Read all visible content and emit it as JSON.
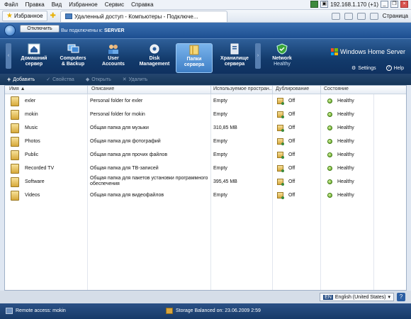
{
  "ie_menu": {
    "items": [
      "Файл",
      "Правка",
      "Вид",
      "Избранное",
      "Сервис",
      "Справка"
    ]
  },
  "ie_status": {
    "address": "192.168.1.170 (+1)"
  },
  "ie_bar": {
    "favorites": "Избранное",
    "tab_title": "Удаленный доступ - Компьютеры - Подключе...",
    "page_label": "Страница"
  },
  "rdp": {
    "disconnect": "Отключить",
    "connected_to": "Вы подключены к:",
    "server": "SERVER"
  },
  "whs": {
    "logo": "Windows Home Server",
    "tabs": [
      {
        "line1": "Домашний",
        "line2": "сервер"
      },
      {
        "line1": "Computers",
        "line2": "& Backup"
      },
      {
        "line1": "User",
        "line2": "Accounts"
      },
      {
        "line1": "Disk",
        "line2": "Management"
      },
      {
        "line1": "Папки",
        "line2": "сервера"
      },
      {
        "line1": "Хранилище",
        "line2": "сервера"
      }
    ],
    "network": {
      "label": "Network",
      "status": "Healthy"
    },
    "settings": "Settings",
    "help": "Help"
  },
  "toolbar": {
    "add": "Добавить",
    "properties": "Свойства",
    "open": "Открыть",
    "delete": "Удалить"
  },
  "table": {
    "headers": {
      "name": "Имя",
      "desc": "Описание",
      "used": "Используемое простран...",
      "dup": "Дублирование",
      "status": "Состояние"
    },
    "rows": [
      {
        "name": "exler",
        "desc": "Personal folder for exler",
        "used": "Empty",
        "dup": "Off",
        "status": "Healthy",
        "icon": "user-folder"
      },
      {
        "name": "mokin",
        "desc": "Personal folder for mokin",
        "used": "Empty",
        "dup": "Off",
        "status": "Healthy",
        "icon": "user-folder"
      },
      {
        "name": "Music",
        "desc": "Общая папка для музыки",
        "used": "310,85 MB",
        "dup": "Off",
        "status": "Healthy",
        "icon": "music-folder"
      },
      {
        "name": "Photos",
        "desc": "Общая папка для фотографий",
        "used": "Empty",
        "dup": "Off",
        "status": "Healthy",
        "icon": "photos-folder"
      },
      {
        "name": "Public",
        "desc": "Общая папка для прочих файлов",
        "used": "Empty",
        "dup": "Off",
        "status": "Healthy",
        "icon": "public-folder"
      },
      {
        "name": "Recorded TV",
        "desc": "Общая папка для ТВ-записей",
        "used": "Empty",
        "dup": "Off",
        "status": "Healthy",
        "icon": "tv-folder"
      },
      {
        "name": "Software",
        "desc": "Общая папка для пакетов установки программного обеспечения",
        "used": "395,45 MB",
        "dup": "Off",
        "status": "Healthy",
        "icon": "software-folder"
      },
      {
        "name": "Videos",
        "desc": "Общая папка для видеофайлов",
        "used": "Empty",
        "dup": "Off",
        "status": "Healthy",
        "icon": "videos-folder"
      }
    ]
  },
  "language": {
    "code": "EN",
    "label": "English (United States)"
  },
  "status_bar": {
    "remote": "Remote access: mokin",
    "balanced": "Storage Balanced on: 23.06.2009 2:59"
  }
}
